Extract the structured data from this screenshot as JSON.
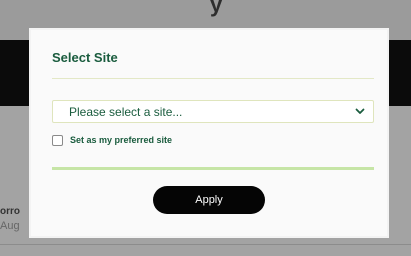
{
  "background": {
    "title_fragment": "y",
    "card_line1": "orro",
    "card_line2": "Aug"
  },
  "modal": {
    "title": "Select Site",
    "select": {
      "placeholder": "Please select a site...",
      "icon": "chevron-down-icon"
    },
    "preferred_checkbox": {
      "label": "Set as my preferred site",
      "checked": false
    },
    "progress": {
      "fraction": 1.0
    },
    "apply_label": "Apply"
  },
  "colors": {
    "accent_green": "#1a5c3e",
    "progress_green": "#c6e5a6",
    "button_black": "#050505"
  }
}
